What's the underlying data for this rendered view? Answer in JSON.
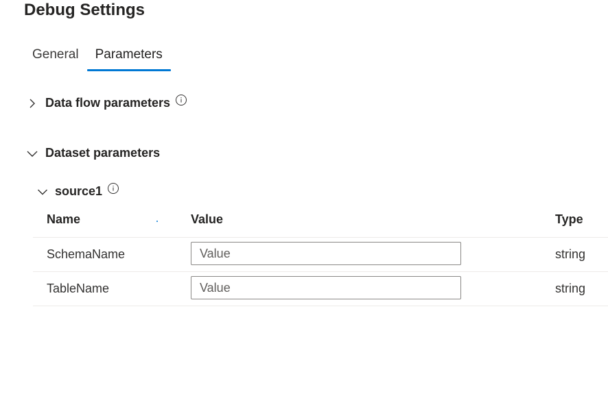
{
  "dialog": {
    "title": "Debug Settings"
  },
  "tabs": [
    {
      "label": "General",
      "active": false
    },
    {
      "label": "Parameters",
      "active": true
    }
  ],
  "sections": {
    "data_flow_parameters": {
      "label": "Data flow parameters",
      "expanded": false,
      "icon": "chevron-right-icon"
    },
    "dataset_parameters": {
      "label": "Dataset parameters",
      "expanded": true,
      "icon": "chevron-down-icon"
    }
  },
  "source": {
    "label": "source1",
    "expanded": true
  },
  "grid": {
    "columns": {
      "name": "Name",
      "value": "Value",
      "type": "Type"
    },
    "rows": [
      {
        "name": "SchemaName",
        "value": "",
        "placeholder": "Value",
        "type": "string"
      },
      {
        "name": "TableName",
        "value": "",
        "placeholder": "Value",
        "type": "string"
      }
    ]
  },
  "colors": {
    "accent": "#0078d4",
    "text": "#323130",
    "border": "#8a8886"
  }
}
